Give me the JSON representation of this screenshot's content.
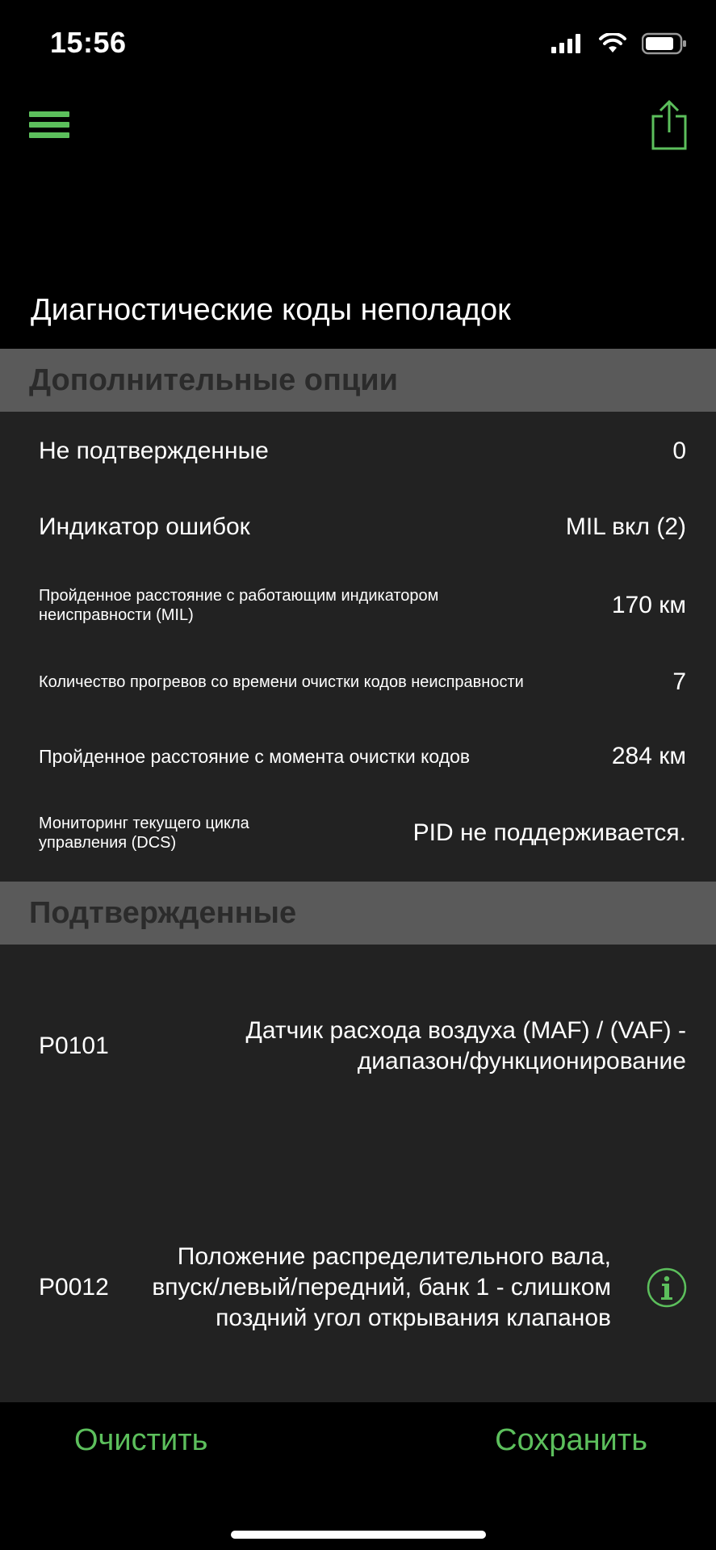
{
  "status": {
    "time": "15:56"
  },
  "page_title": "Диагностические коды неполадок",
  "sections": {
    "options_title": "Дополнительные опции",
    "confirmed_title": "Подтвержденные"
  },
  "options": [
    {
      "label": "Не подтвержденные",
      "value": "0"
    },
    {
      "label": "Индикатор ошибок",
      "value": "MIL вкл (2)"
    },
    {
      "label": "Пройденное расстояние с работающим индикатором неисправности (MIL)",
      "value": "170 км"
    },
    {
      "label": "Количество прогревов со времени очистки кодов неисправности",
      "value": "7"
    },
    {
      "label": "Пройденное расстояние с момента очистки кодов",
      "value": "284 км"
    },
    {
      "label": "Мониторинг текущего цикла управления (DCS)",
      "value": "PID не поддерживается."
    }
  ],
  "codes": [
    {
      "code": "P0101",
      "description": "Датчик расхода воздуха (MAF) / (VAF) - диапазон/функционирование"
    },
    {
      "code": "P0012",
      "description": "Положение распределительного вала, впуск/левый/передний, банк 1 - слишком поздний угол открывания клапанов"
    }
  ],
  "buttons": {
    "clear": "Очистить",
    "save": "Сохранить"
  },
  "colors": {
    "accent": "#5cbf5c",
    "section_bg": "#5a5a5a",
    "panel_bg": "#222222"
  },
  "icons": [
    "menu-icon",
    "share-icon",
    "info-icon",
    "signal-icon",
    "wifi-icon",
    "battery-icon"
  ]
}
